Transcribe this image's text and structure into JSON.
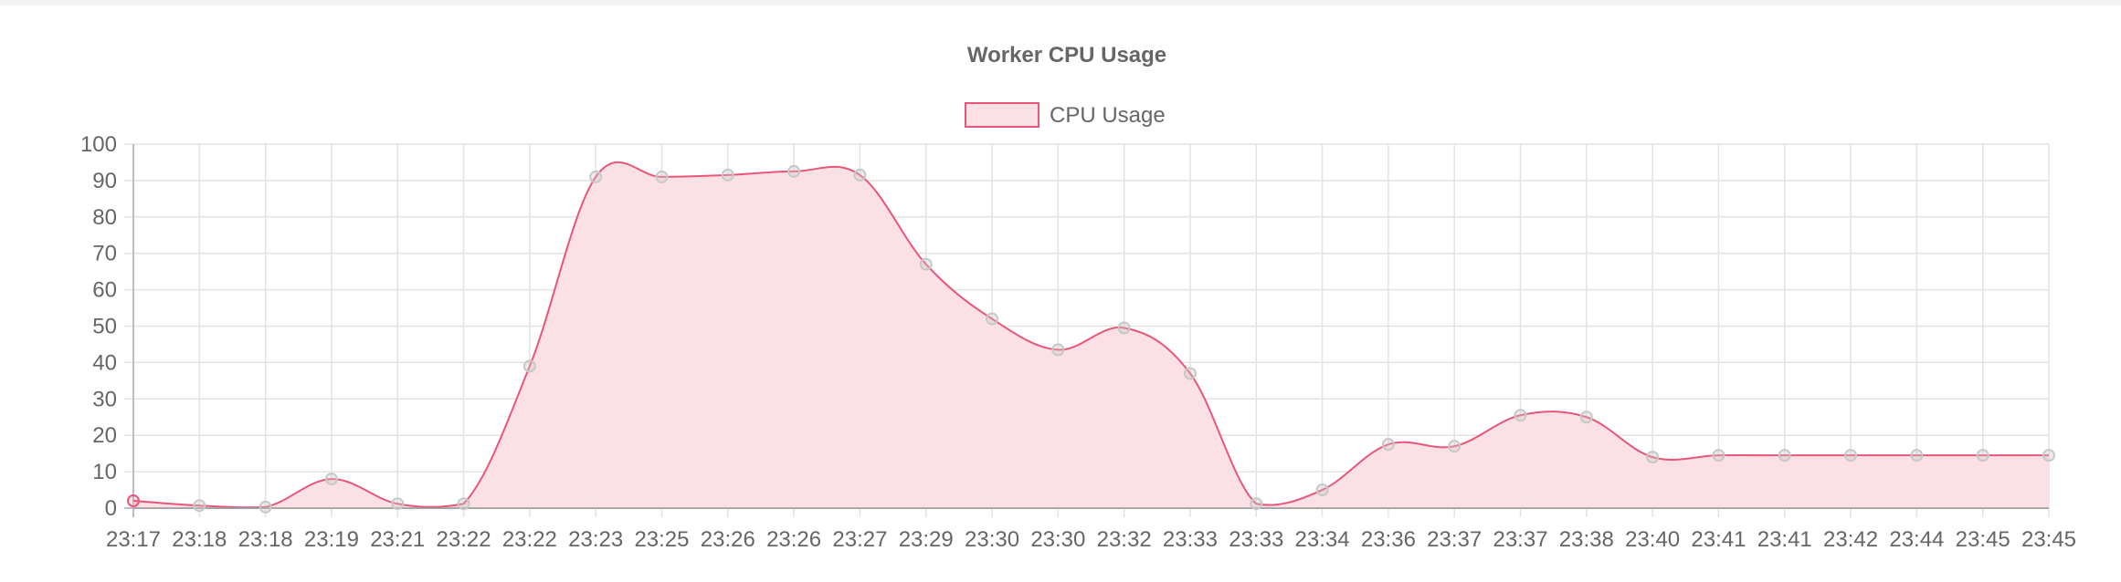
{
  "chart_data": {
    "type": "area",
    "title": "Worker CPU Usage",
    "xlabel": "",
    "ylabel": "",
    "ylim": [
      0,
      100
    ],
    "yticks": [
      0,
      10,
      20,
      30,
      40,
      50,
      60,
      70,
      80,
      90,
      100
    ],
    "grid": true,
    "legend_position": "top-center",
    "categories": [
      "23:17",
      "23:18",
      "23:18",
      "23:19",
      "23:21",
      "23:22",
      "23:22",
      "23:23",
      "23:25",
      "23:26",
      "23:26",
      "23:27",
      "23:29",
      "23:30",
      "23:30",
      "23:32",
      "23:33",
      "23:33",
      "23:34",
      "23:36",
      "23:37",
      "23:37",
      "23:38",
      "23:40",
      "23:41",
      "23:41",
      "23:42",
      "23:44",
      "23:45",
      "23:45"
    ],
    "series": [
      {
        "name": "CPU Usage",
        "values": [
          2,
          0.7,
          0.3,
          8,
          1.2,
          1.2,
          39,
          91,
          91,
          91.5,
          92.5,
          91.5,
          67,
          52,
          43.5,
          49.5,
          37,
          1.2,
          5,
          17.5,
          17,
          25.5,
          25,
          14,
          14.5,
          14.5,
          14.5,
          14.5,
          14.5,
          14.5
        ],
        "line_color": "#e8577a",
        "fill_color": "#fbe1e6",
        "point_color": "#c8c8c8"
      }
    ]
  }
}
